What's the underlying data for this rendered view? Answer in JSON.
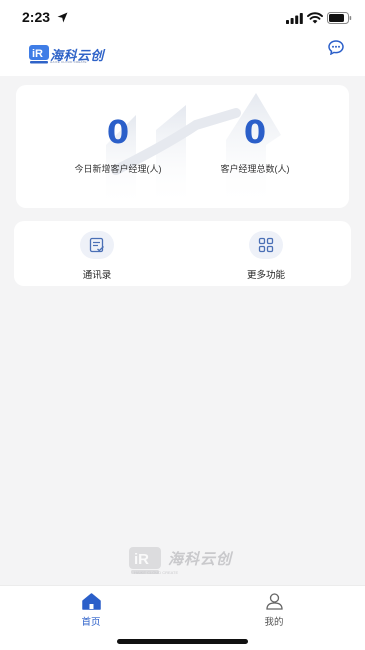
{
  "status_bar": {
    "time": "2:23"
  },
  "header": {
    "logo_text": "海科云创",
    "logo_sub": "HAIKE CLOUD CREATE",
    "message_icon": "chat-bubble-icon"
  },
  "stats": [
    {
      "value": "0",
      "label": "今日新增客户经理(人)"
    },
    {
      "value": "0",
      "label": "客户经理总数(人)"
    }
  ],
  "functions": [
    {
      "label": "通讯录",
      "icon": "contacts-icon"
    },
    {
      "label": "更多功能",
      "icon": "grid-icon"
    }
  ],
  "watermark": {
    "text": "海科云创",
    "sub": "HAIKE CLOUD CREATE"
  },
  "tabs": [
    {
      "label": "首页",
      "icon": "home-icon",
      "active": true
    },
    {
      "label": "我的",
      "icon": "user-icon",
      "active": false
    }
  ],
  "colors": {
    "accent": "#2b5fc9",
    "tab_inactive": "#555555",
    "background": "#f4f4f5"
  }
}
